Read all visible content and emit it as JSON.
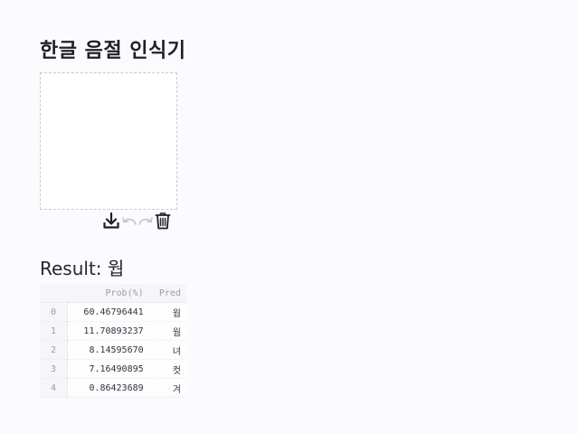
{
  "title": "한글 음절 인식기",
  "toolbar": {
    "download_icon": "download-icon",
    "undo_icon": "undo-icon",
    "redo_icon": "redo-icon",
    "delete_icon": "trash-icon"
  },
  "result": {
    "label": "Result:",
    "value": "웝"
  },
  "table": {
    "columns": [
      "",
      "Prob(%)",
      "Pred"
    ],
    "rows": [
      {
        "index": "0",
        "prob": "60.46796441",
        "pred": "웝"
      },
      {
        "index": "1",
        "prob": "11.70893237",
        "pred": "웜"
      },
      {
        "index": "2",
        "prob": "8.14595670",
        "pred": "녀"
      },
      {
        "index": "3",
        "prob": "7.16490895",
        "pred": "컷"
      },
      {
        "index": "4",
        "prob": "0.86423689",
        "pred": "겨"
      }
    ]
  }
}
